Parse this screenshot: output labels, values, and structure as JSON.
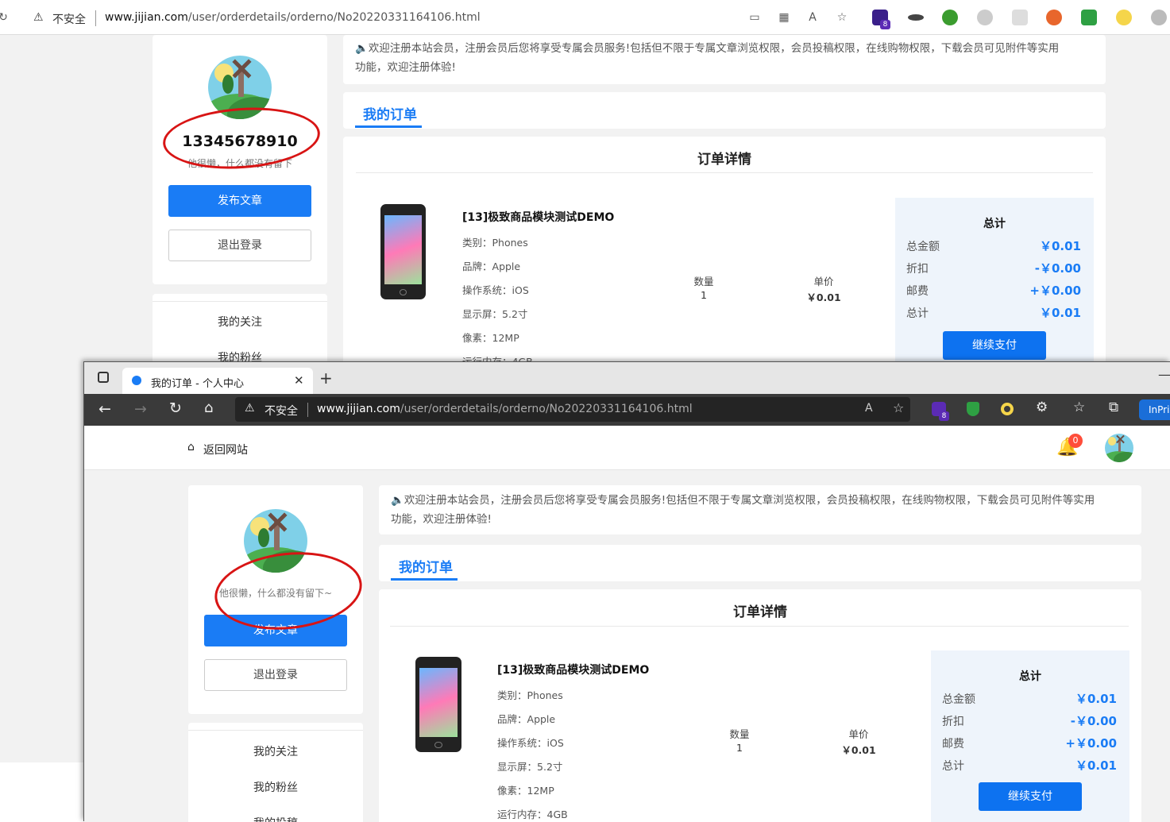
{
  "back_browser": {
    "insecure_label": "不安全",
    "url_domain": "www.jijian.com",
    "url_path": "/user/orderdetails/orderno/No20220331164106.html",
    "ext_badge": "8"
  },
  "front_browser": {
    "tab_title": "我的订单 - 个人中心",
    "insecure_label": "不安全",
    "url_domain": "www.jijian.com",
    "url_path": "/user/orderdetails/orderno/No20220331164106.html",
    "ext_badge": "8",
    "inprivate": "InPriv"
  },
  "site_header": {
    "back_label": "返回网站",
    "notification_count": "0"
  },
  "back_page": {
    "username": "13345678910",
    "signature": "他很懒，什么都没有留下",
    "publish_button": "发布文章",
    "logout_button": "退出登录",
    "menu": [
      "我的关注",
      "我的粉丝"
    ]
  },
  "front_page": {
    "signature": "他很懒，什么都没有留下~",
    "publish_button": "发布文章",
    "logout_button": "退出登录",
    "menu": [
      "我的关注",
      "我的粉丝",
      "我的投稿"
    ]
  },
  "notice": {
    "icon": "speaker-icon",
    "text_line1": "欢迎注册本站会员，注册会员后您将享受专属会员服务!包括但不限于专属文章浏览权限，会员投稿权限，在线购物权限，下载会员可见附件等实用",
    "text_line2": "功能，欢迎注册体验!"
  },
  "tab": {
    "label": "我的订单"
  },
  "order": {
    "section_title": "订单详情",
    "product_name": "[13]极致商品模块测试DEMO",
    "attributes": [
      {
        "label": "类别：",
        "value": "Phones"
      },
      {
        "label": "品牌：",
        "value": "Apple"
      },
      {
        "label": "操作系统：",
        "value": "iOS"
      },
      {
        "label": "显示屏：",
        "value": "5.2寸"
      },
      {
        "label": "像素：",
        "value": "12MP"
      },
      {
        "label": "运行内存：",
        "value": "4GB"
      }
    ],
    "qty_header": "数量",
    "qty_value": "1",
    "price_header": "单价",
    "price_value": "￥0.01"
  },
  "totals": {
    "title": "总计",
    "rows": [
      {
        "label": "总金额",
        "value": "￥0.01"
      },
      {
        "label": "折扣",
        "value": "-￥0.00"
      },
      {
        "label": "邮费",
        "value": "+￥0.00"
      },
      {
        "label": "总计",
        "value": "￥0.01"
      }
    ],
    "pay_button": "继续支付"
  },
  "colors": {
    "accent": "#1a7cf5",
    "annotation_red": "#d81414",
    "page_bg": "#f2f2f2"
  }
}
